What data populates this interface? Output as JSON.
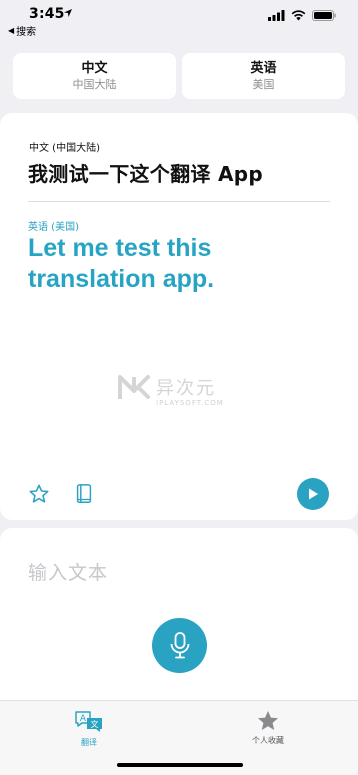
{
  "status_bar": {
    "time": "3:45",
    "back_label": "搜索"
  },
  "languages": {
    "source": {
      "name": "中文",
      "region": "中国大陆"
    },
    "target": {
      "name": "英语",
      "region": "美国"
    }
  },
  "translation": {
    "source_label": "中文 (中国大陆)",
    "source_text": "我测试一下这个翻译 App",
    "target_label": "英语 (美国)",
    "target_text": "Let me test this translation app."
  },
  "watermark": {
    "title": "异次元",
    "subtitle": "IPLAYSOFT.COM"
  },
  "input": {
    "placeholder": "输入文本"
  },
  "tabs": [
    {
      "label": "翻译",
      "icon": "translate-icon",
      "active": true
    },
    {
      "label": "个人收藏",
      "icon": "star-icon",
      "active": false
    }
  ],
  "colors": {
    "accent": "#2aa3c2",
    "background": "#efeff4",
    "card": "#ffffff"
  }
}
